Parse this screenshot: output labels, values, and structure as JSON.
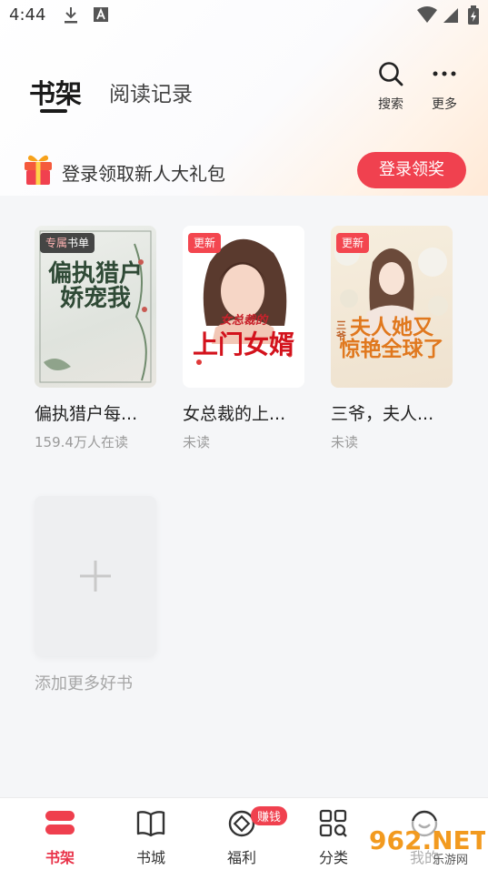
{
  "status_bar": {
    "time": "4:44",
    "icons": [
      "download-icon",
      "font-icon",
      "wifi-icon",
      "signal-icon",
      "battery-icon"
    ]
  },
  "header": {
    "tabs": [
      {
        "label": "书架",
        "active": true
      },
      {
        "label": "阅读记录",
        "active": false
      }
    ],
    "actions": [
      {
        "icon": "search-icon",
        "label": "搜索"
      },
      {
        "icon": "more-icon",
        "label": "更多"
      }
    ]
  },
  "promo": {
    "text": "登录领取新人大礼包",
    "button": "登录领奖",
    "icon": "gift-icon"
  },
  "books": [
    {
      "badge_a": "专属",
      "badge_b": "书单",
      "cover_text": "偏执猎户\n娇宠我",
      "title": "偏执猎户每...",
      "subtitle": "159.4万人在读"
    },
    {
      "badge": "更新",
      "cover_text": "上门女婿",
      "cover_sub": "女总裁的",
      "title": "女总裁的上...",
      "subtitle": "未读"
    },
    {
      "badge": "更新",
      "cover_text": "夫人她又\n惊艳全球了",
      "cover_sub": "三爷",
      "title": "三爷，夫人...",
      "subtitle": "未读"
    }
  ],
  "add_more": {
    "label": "添加更多好书",
    "icon": "plus-icon"
  },
  "bottom_nav": [
    {
      "label": "书架",
      "icon": "bookshelf-icon",
      "active": true
    },
    {
      "label": "书城",
      "icon": "book-icon",
      "active": false
    },
    {
      "label": "福利",
      "icon": "coin-icon",
      "active": false,
      "badge": "赚钱"
    },
    {
      "label": "分类",
      "icon": "category-icon",
      "active": false
    },
    {
      "label": "我的",
      "icon": "profile-icon",
      "active": false
    }
  ],
  "watermark": {
    "text": "962.NET",
    "sub": "乐游网"
  },
  "colors": {
    "accent": "#f0414f",
    "active_tab": "#e9344a",
    "background": "#f5f6f8"
  }
}
